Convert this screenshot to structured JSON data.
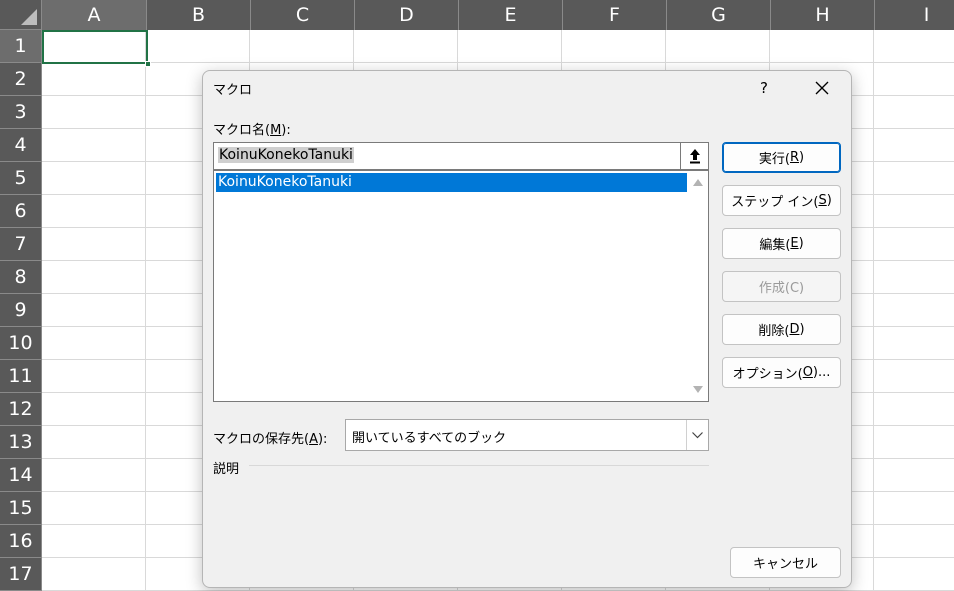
{
  "sheet": {
    "columns": [
      "A",
      "B",
      "C",
      "D",
      "E",
      "F",
      "G",
      "H",
      "I"
    ],
    "rows": [
      "1",
      "2",
      "3",
      "4",
      "5",
      "6",
      "7",
      "8",
      "9",
      "10",
      "11",
      "12",
      "13",
      "14",
      "15",
      "16",
      "17"
    ],
    "active_cell": "A1",
    "accent_color": "#217346"
  },
  "dialog": {
    "title": "マクロ",
    "help_label": "?",
    "close_icon": "close-icon",
    "macro_name_label_prefix": "マクロ名(",
    "macro_name_label_key": "M",
    "macro_name_label_suffix": "):",
    "macro_name_value": "KoinuKonekoTanuki",
    "macro_list": [
      "KoinuKonekoTanuki"
    ],
    "selected_macro_index": 0,
    "selection_color": "#0078d7",
    "buttons": {
      "run": {
        "prefix": "実行(",
        "key": "R",
        "suffix": ")"
      },
      "step_into": {
        "prefix": "ステップ イン(",
        "key": "S",
        "suffix": ")"
      },
      "edit": {
        "prefix": "編集(",
        "key": "E",
        "suffix": ")"
      },
      "create": {
        "label": "作成(C)",
        "disabled": true
      },
      "delete": {
        "prefix": "削除(",
        "key": "D",
        "suffix": ")"
      },
      "options": {
        "prefix": "オプション(",
        "key": "O",
        "suffix": ")..."
      },
      "cancel": "キャンセル"
    },
    "store_label_prefix": "マクロの保存先(",
    "store_label_key": "A",
    "store_label_suffix": "):",
    "store_value": "開いているすべてのブック",
    "description_label": "説明"
  }
}
